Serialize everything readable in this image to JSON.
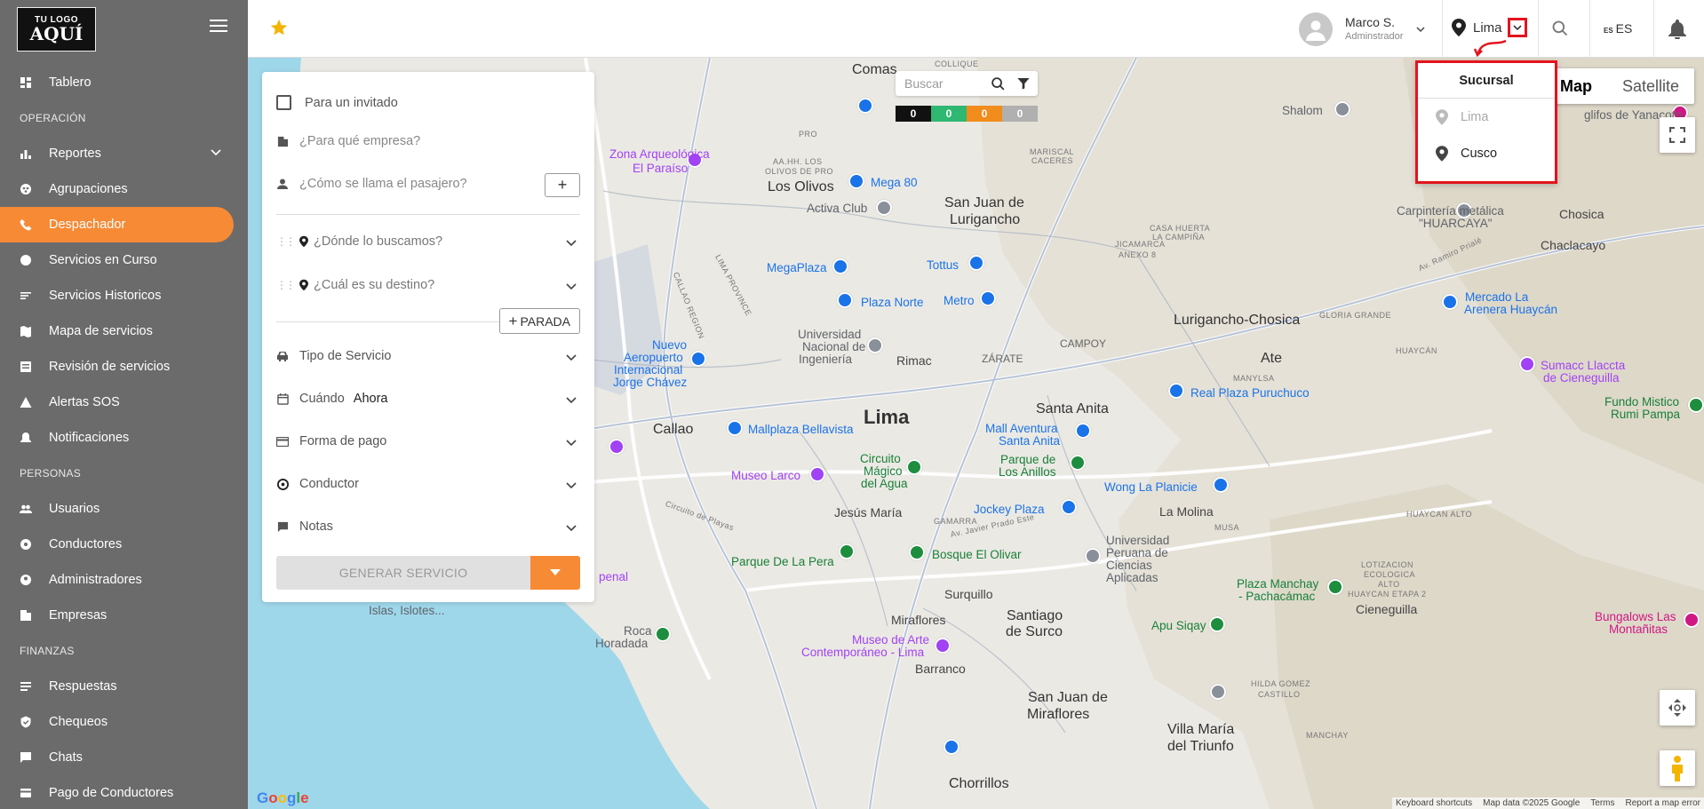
{
  "sidebar": {
    "logo_line1": "TU LOGO",
    "logo_line2": "AQUÍ",
    "items": [
      {
        "type": "item",
        "label": "Tablero",
        "icon": "dashboard-icon"
      },
      {
        "type": "section",
        "label": "OPERACIÓN"
      },
      {
        "type": "item",
        "label": "Reportes",
        "icon": "bar-chart-icon",
        "expandable": true
      },
      {
        "type": "item",
        "label": "Agrupaciones",
        "icon": "group-icon"
      },
      {
        "type": "item",
        "label": "Despachador",
        "icon": "phone-icon",
        "active": true
      },
      {
        "type": "item",
        "label": "Servicios en Curso",
        "icon": "circle-icon"
      },
      {
        "type": "item",
        "label": "Servicios Historicos",
        "icon": "list-icon"
      },
      {
        "type": "item",
        "label": "Mapa de servicios",
        "icon": "map-icon"
      },
      {
        "type": "item",
        "label": "Revisión de servicios",
        "icon": "receipt-icon"
      },
      {
        "type": "item",
        "label": "Alertas SOS",
        "icon": "warning-icon"
      },
      {
        "type": "item",
        "label": "Notificaciones",
        "icon": "bell-icon"
      },
      {
        "type": "section",
        "label": "PERSONAS"
      },
      {
        "type": "item",
        "label": "Usuarios",
        "icon": "users-icon"
      },
      {
        "type": "item",
        "label": "Conductores",
        "icon": "steering-icon"
      },
      {
        "type": "item",
        "label": "Administradores",
        "icon": "admin-icon"
      },
      {
        "type": "item",
        "label": "Empresas",
        "icon": "building-icon"
      },
      {
        "type": "section",
        "label": "FINANZAS"
      },
      {
        "type": "item",
        "label": "Respuestas",
        "icon": "response-icon"
      },
      {
        "type": "item",
        "label": "Chequeos",
        "icon": "shield-check-icon"
      },
      {
        "type": "item",
        "label": "Chats",
        "icon": "chat-icon"
      },
      {
        "type": "item",
        "label": "Pago de Conductores",
        "icon": "payment-icon"
      }
    ]
  },
  "topbar": {
    "user_name": "Marco S.",
    "user_role": "Adminstrador",
    "branch": "Lima",
    "lang_flag": "ES",
    "lang": "ES"
  },
  "branch_dropdown": {
    "title": "Sucursal",
    "options": [
      {
        "label": "Lima",
        "disabled": true
      },
      {
        "label": "Cusco",
        "disabled": false
      }
    ]
  },
  "form": {
    "guest_label": "Para un invitado",
    "company_placeholder": "¿Para qué empresa?",
    "passenger_placeholder": "¿Cómo se llama el pasajero?",
    "pickup_placeholder": "¿Dónde lo buscamos?",
    "destination_placeholder": "¿Cuál es su destino?",
    "stop_button": "PARADA",
    "service_type": "Tipo de Servicio",
    "when_label": "Cuándo",
    "when_value": "Ahora",
    "payment": "Forma de pago",
    "driver": "Conductor",
    "notes": "Notas",
    "generate": "GENERAR SERVICIO"
  },
  "map": {
    "search_placeholder": "Buscar",
    "counters": [
      {
        "value": "0",
        "color": "#111111"
      },
      {
        "value": "0",
        "color": "#2eb872"
      },
      {
        "value": "0",
        "color": "#f28c1d"
      },
      {
        "value": "0",
        "color": "#b0b0b0"
      }
    ],
    "map_type": [
      "Map",
      "Satellite"
    ],
    "labels": {
      "lima": "Lima",
      "callao": "Callao",
      "los_olivos": "Los Olivos",
      "comas": "Comas",
      "sjl_1": "San Juan de",
      "sjl_2": "Lurigancho",
      "lurigancho": "Lurigancho-Chosica",
      "ate": "Ate",
      "santa_anita": "Santa Anita",
      "rimac": "Rimac",
      "jesus_maria": "Jesús María",
      "la_molina": "La Molina",
      "surquillo": "Surquillo",
      "miraflores": "Miraflores",
      "santiago_1": "Santiago",
      "santiago_2": "de Surco",
      "barranco": "Barranco",
      "sjm_1": "San Juan de",
      "sjm_2": "Miraflores",
      "vmt_1": "Villa María",
      "vmt_2": "del Triunfo",
      "chorrillos": "Chorrillos",
      "cieneguilla": "Cieneguilla",
      "chosica": "Chosica",
      "chaclacayo": "Chaclacayo",
      "campoy": "CAMPOY",
      "zarate": "ZÁRATE",
      "mega80": "Mega 80",
      "activa": "Activa Club",
      "megaplaza": "MegaPlaza",
      "plaza_norte": "Plaza Norte",
      "tottus": "Tottus",
      "metro": "Metro",
      "aeropuerto_1": "Nuevo",
      "aeropuerto_2": "Aeropuerto",
      "aeropuerto_3": "Internacional",
      "aeropuerto_4": "Jorge Chávez",
      "uni_1": "Universidad",
      "uni_2": "Nacional de",
      "uni_3": "Ingeniería",
      "mallplaza": "Mallplaza Bellavista",
      "circuito_1": "Circuito",
      "circuito_2": "Mágico",
      "circuito_3": "del Agua",
      "museo_larco": "Museo Larco",
      "mall_aventura_1": "Mall Aventura",
      "mall_aventura_2": "Santa Anita",
      "parque_1": "Parque de",
      "parque_2": "Los Anillos",
      "real_plaza": "Real Plaza Puruchuco",
      "wong": "Wong La Planicie",
      "jockey": "Jockey Plaza",
      "parque_pera": "Parque De La Pera",
      "bosque": "Bosque El Olivar",
      "upc_1": "Universidad",
      "upc_2": "Peruana de",
      "upc_3": "Ciencias",
      "upc_4": "Aplicadas",
      "manchay_1": "Plaza Manchay",
      "manchay_2": "- Pachacámac",
      "apu": "Apu Siqay",
      "mac_1": "Museo de Arte",
      "mac_2": "Contemporáneo - Lima",
      "roca_1": "Roca",
      "roca_2": "Horadada",
      "shalom": "Shalom",
      "carpinteria_1": "Carpintería metálica",
      "carpinteria_2": "\"HUARCAYA\"",
      "mercado_1": "Mercado La",
      "mercado_2": "Arenera Huaycán",
      "sumacc_1": "Sumacc Llaccta",
      "sumacc_2": "de Cieneguilla",
      "fundo_1": "Fundo Mistico",
      "fundo_2": "Rumi Pampa",
      "bungalows_1": "Bungalows Las",
      "bungalows_2": "Montañitas",
      "arqueologica_1": "Zona Arqueológica",
      "arqueologica_2": "El Paraíso",
      "islas": "Islas, Islotes...",
      "penal": "penal",
      "hilda_1": "HILDA GOMEZ",
      "hilda_2": "CASTILLO",
      "jicamarca_1": "JICAMARCA",
      "jicamarca_2": "ANEXO 8",
      "huaycan": "HUAYCÁN",
      "manylsa": "MANYLSA",
      "lotizacion_1": "LOTIZACION",
      "lotizacion_2": "ECOLOGICA",
      "lotizacion_3": "ALTO",
      "lotizacion_4": "HUAYCAN ETAPA 2",
      "huaycan_alto": "HUAYCAN ALTO",
      "musa": "MUSA",
      "gamarra": "GAMARRA",
      "manchay_d": "MANCHAY",
      "gloria": "GLORIA GRANDE",
      "olivos_pro_1": "AA.HH. LOS",
      "olivos_pro_2": "OLIVOS DE PRO",
      "mariscal_1": "MARISCAL",
      "mariscal_2": "CACERES",
      "callao_region": "CALLAO REGION",
      "lima_province": "LIMA PROVINCE",
      "collique": "COLLIQUE",
      "pro": "PRO",
      "yanacoto": "glifos de Yanacoto",
      "circuito_playas": "Circuito de Playas",
      "javier_prado": "Av. Javier Prado Este",
      "ramiro_priale": "Av. Ramiro Prialé",
      "huertos": "LA CAMPIÑA",
      "casa_huerta": "CASA HUERTA"
    },
    "attribution": [
      "Keyboard shortcuts",
      "Map data ©2025 Google",
      "Terms",
      "Report a map error"
    ],
    "google": "Google"
  },
  "colors": {
    "accent": "#f68a35",
    "sidebar": "#6b6b6b",
    "highlight": "#e3141e"
  }
}
